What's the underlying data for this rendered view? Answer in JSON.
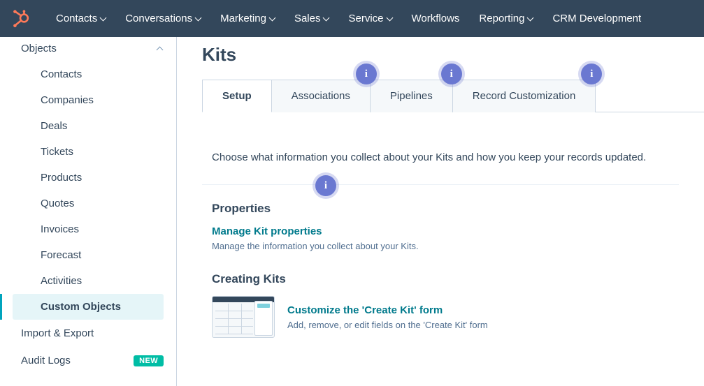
{
  "topnav": {
    "items": [
      {
        "label": "Contacts",
        "dropdown": true
      },
      {
        "label": "Conversations",
        "dropdown": true
      },
      {
        "label": "Marketing",
        "dropdown": true
      },
      {
        "label": "Sales",
        "dropdown": true
      },
      {
        "label": "Service",
        "dropdown": true
      },
      {
        "label": "Workflows",
        "dropdown": false
      },
      {
        "label": "Reporting",
        "dropdown": true
      },
      {
        "label": "CRM Development",
        "dropdown": false
      }
    ]
  },
  "sidebar": {
    "group_header": "Objects",
    "sub_items": [
      {
        "label": "Contacts"
      },
      {
        "label": "Companies"
      },
      {
        "label": "Deals"
      },
      {
        "label": "Tickets"
      },
      {
        "label": "Products"
      },
      {
        "label": "Quotes"
      },
      {
        "label": "Invoices"
      },
      {
        "label": "Forecast"
      },
      {
        "label": "Activities"
      },
      {
        "label": "Custom Objects",
        "active": true
      }
    ],
    "top_items": [
      {
        "label": "Import & Export"
      },
      {
        "label": "Audit Logs",
        "badge": "NEW"
      }
    ]
  },
  "main": {
    "title": "Kits",
    "tabs": [
      {
        "label": "Setup",
        "active": true
      },
      {
        "label": "Associations"
      },
      {
        "label": "Pipelines"
      },
      {
        "label": "Record Customization"
      }
    ],
    "description": "Choose what information you collect about your Kits and how you keep your records updated.",
    "sections": {
      "properties": {
        "title": "Properties",
        "link": "Manage Kit properties",
        "subtext": "Manage the information you collect about your Kits."
      },
      "creating": {
        "title": "Creating Kits",
        "link": "Customize the 'Create Kit' form",
        "subtext": "Add, remove, or edit fields on the 'Create Kit' form"
      }
    }
  },
  "info_glyph": "i",
  "colors": {
    "navbar": "#33475b",
    "accent": "#00a4bd",
    "link": "#007a8c",
    "pin": "#6a78d1",
    "badge": "#00bda5"
  }
}
